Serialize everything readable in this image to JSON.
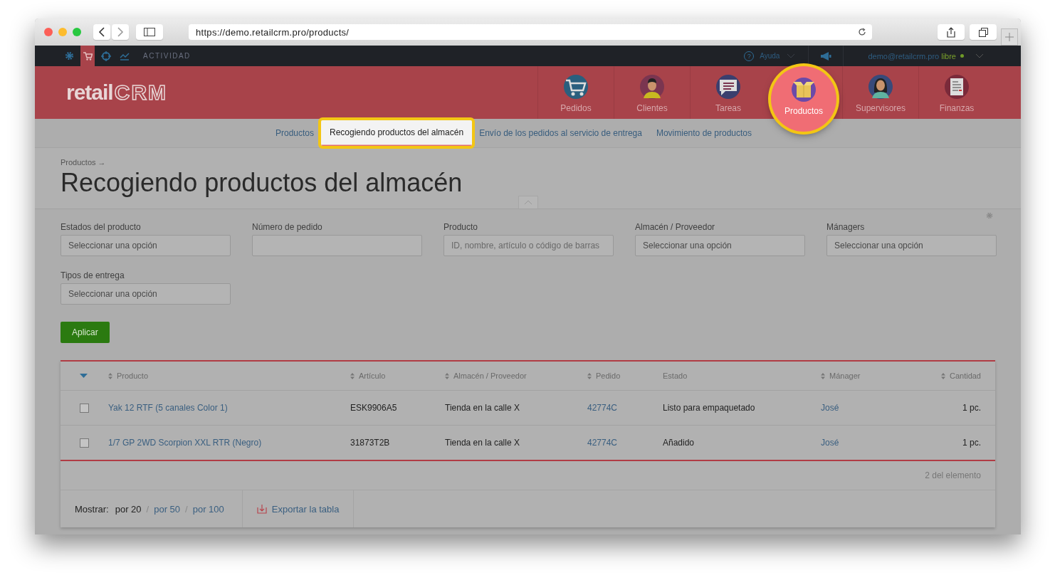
{
  "browser": {
    "url": "https://demo.retailcrm.pro/products/"
  },
  "topbar": {
    "items": [
      {
        "kind": "gear",
        "selected": false
      },
      {
        "kind": "cart",
        "selected": true
      },
      {
        "kind": "target",
        "selected": false
      },
      {
        "kind": "chart",
        "selected": false
      }
    ],
    "activity": "ACTIVIDAD",
    "help_icon": "?",
    "help": "Ayuda",
    "user": "demo@retailcrm.pro",
    "status": "libre"
  },
  "header": {
    "logo_a": "retail",
    "logo_b": "CRM",
    "nav": [
      {
        "label": "Pedidos",
        "kind": "cart",
        "selected": false
      },
      {
        "label": "Clientes",
        "kind": "man",
        "selected": false
      },
      {
        "label": "Tareas",
        "kind": "chat",
        "selected": false
      },
      {
        "label": "Productos",
        "kind": "box",
        "selected": true
      },
      {
        "label": "Supervisores",
        "kind": "woman",
        "selected": false
      },
      {
        "label": "Finanzas",
        "kind": "doc",
        "selected": false
      }
    ]
  },
  "subnav": [
    {
      "label": "Productos",
      "selected": false
    },
    {
      "label": "Recogiendo productos del almacén",
      "selected": true
    },
    {
      "label": "Envío de los pedidos al servicio de entrega",
      "selected": false
    },
    {
      "label": "Movimiento de productos",
      "selected": false
    }
  ],
  "breadcrumb": "Productos →",
  "title": "Recogiendo productos del almacén",
  "filters": [
    {
      "label": "Estados del producto",
      "placeholder": "Seleccionar una opción"
    },
    {
      "label": "Número de pedido"
    },
    {
      "label": "Producto",
      "placeholder": "ID, nombre, artículo o código de barras"
    },
    {
      "label": "Almacén / Proveedor",
      "placeholder": "Seleccionar una opción"
    },
    {
      "label": "Mánagers",
      "placeholder": "Seleccionar una opción"
    },
    {
      "label": "Tipos de entrega",
      "placeholder": "Seleccionar una opción"
    }
  ],
  "apply": "Aplicar",
  "table": {
    "columns": [
      {
        "label": "Producto",
        "sortable": true,
        "kind": "link"
      },
      {
        "label": "Artículo",
        "sortable": true,
        "kind": "text"
      },
      {
        "label": "Almacén / Proveedor",
        "sortable": true,
        "kind": "text"
      },
      {
        "label": "Pedido",
        "sortable": true,
        "kind": "link"
      },
      {
        "label": "Estado",
        "sortable": false,
        "kind": "text"
      },
      {
        "label": "Mánager",
        "sortable": true,
        "kind": "link"
      },
      {
        "label": "Cantidad",
        "sortable": true,
        "kind": "text"
      }
    ],
    "rows": [
      {
        "checked": false,
        "cells": [
          "Yak 12 RTF (5 canales Color 1)",
          "ESK9906A5",
          "Tienda en la calle X",
          "42774C",
          "Listo para empaquetado",
          "José",
          "1 pc."
        ]
      },
      {
        "checked": false,
        "cells": [
          "1/7 GP 2WD Scorpion XXL RTR (Negro)",
          "31873T2B",
          "Tienda en la calle X",
          "42774C",
          "Añadido",
          "José",
          "1 pc."
        ]
      }
    ],
    "total": "2 del elemento"
  },
  "footer": {
    "show_label": "Mostrar:",
    "separator": "/",
    "page_sizes": [
      {
        "label": "por 20",
        "selected": true
      },
      {
        "label": "por 50",
        "selected": false
      },
      {
        "label": "por 100",
        "selected": false
      }
    ],
    "export": "Exportar la tabla"
  }
}
